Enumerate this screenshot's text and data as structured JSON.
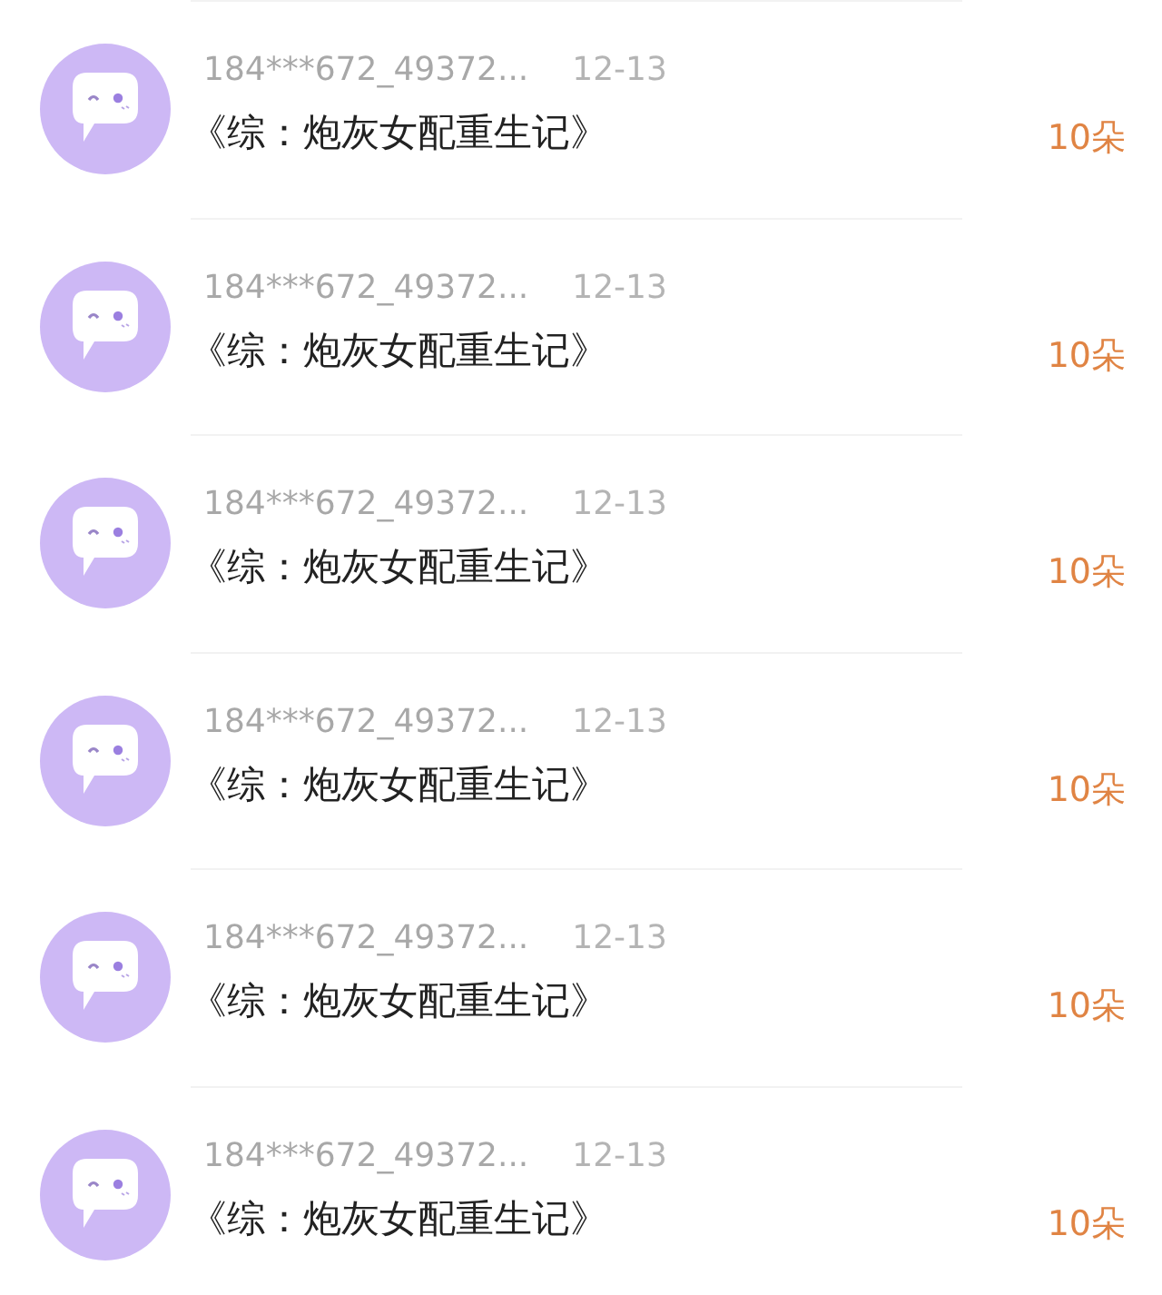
{
  "items": [
    {
      "user": "184***672_49372...",
      "date": "12-13",
      "title": "《综：炮灰女配重生记》",
      "amount": "10朵"
    },
    {
      "user": "184***672_49372...",
      "date": "12-13",
      "title": "《综：炮灰女配重生记》",
      "amount": "10朵"
    },
    {
      "user": "184***672_49372...",
      "date": "12-13",
      "title": "《综：炮灰女配重生记》",
      "amount": "10朵"
    },
    {
      "user": "184***672_49372...",
      "date": "12-13",
      "title": "《综：炮灰女配重生记》",
      "amount": "10朵"
    },
    {
      "user": "184***672_49372...",
      "date": "12-13",
      "title": "《综：炮灰女配重生记》",
      "amount": "10朵"
    },
    {
      "user": "184***672_49372...",
      "date": "12-13",
      "title": "《综：炮灰女配重生记》",
      "amount": "10朵"
    }
  ]
}
